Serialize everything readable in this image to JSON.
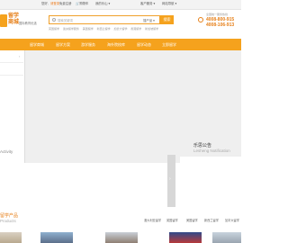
{
  "topbar": {
    "greeting": "您好,",
    "login": "请登录",
    "register": "免费注册",
    "cart": "购物车",
    "my_leshan": "我的乐山",
    "customer_service": "客户服务",
    "site_nav": "网站导航"
  },
  "brand": {
    "logo_line1": "留学",
    "logo_line2": "商城",
    "slogan": "国际教育优选"
  },
  "search": {
    "placeholder": "搜索关键词",
    "scope": "搜产品",
    "button": "搜索",
    "hotwords": [
      "英国留学",
      "澳洲留学服务",
      "美国留学",
      "新西兰留学",
      "加拿大留学",
      "香港留学",
      "新加坡留学"
    ]
  },
  "hotline": {
    "caption": "全国统一服务热线",
    "phone1": "4008-800-915",
    "phone2": "4008-106-913"
  },
  "nav": {
    "items": [
      "留学商城",
      "留学方案",
      "游学服务",
      "海外院校库",
      "留学动态",
      "立即留学"
    ]
  },
  "banner": {
    "side_text": "Activity"
  },
  "notice": {
    "title": "乐思公告",
    "subtitle": "Lesheng Notification"
  },
  "products": {
    "title": "留学产品",
    "subtitle": "Products",
    "tabs": [
      "澳大利亚留学",
      "英国留学",
      "美国留学",
      "新西兰留学",
      "加拿大留学"
    ]
  },
  "colors": {
    "accent": "#f5a21d",
    "brand_text": "#e67e16"
  }
}
